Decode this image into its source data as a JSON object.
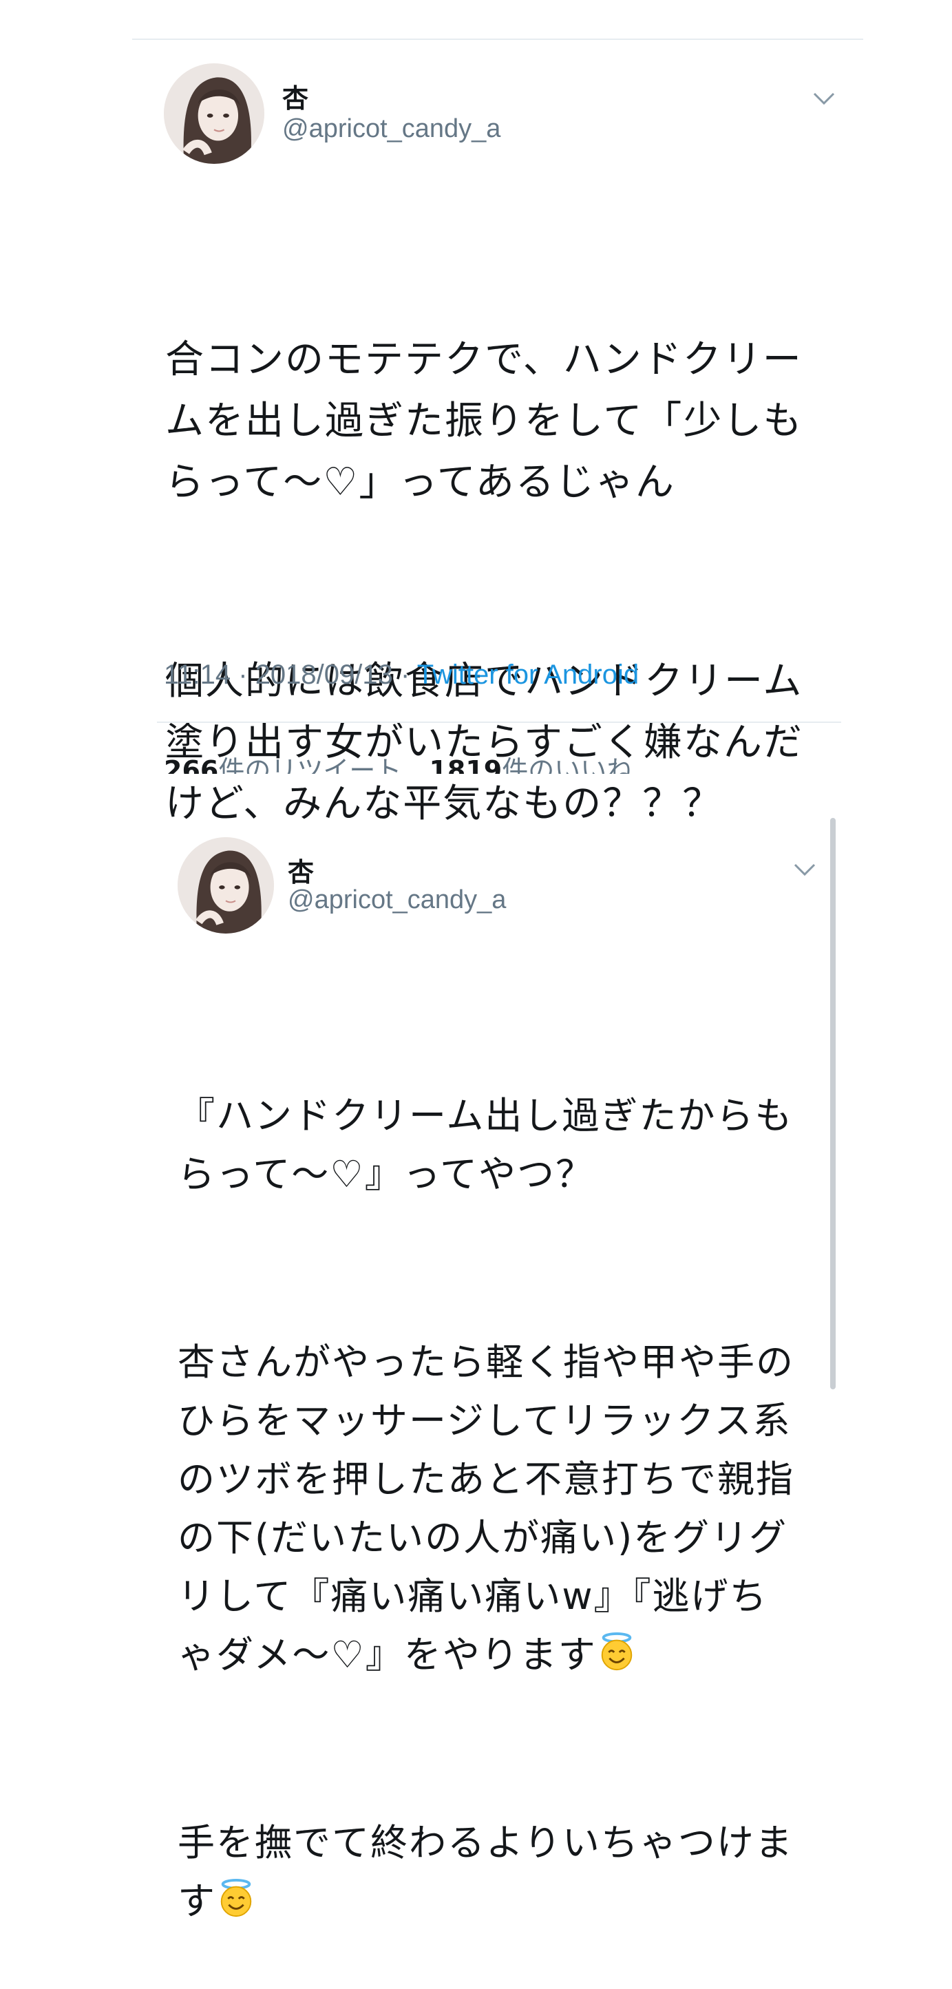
{
  "tweet": {
    "display_name": "杏",
    "handle": "@apricot_candy_a",
    "paragraphs": [
      "合コンのモテテクで、ハンドクリー\nムを出し過ぎた振りをして「少しも\nらって〜♡」ってあるじゃん",
      "個人的には飲食店でハンドクリーム\n塗り出す女がいたらすごく嫌なんだ\nけど、みんな平気なもの？？？"
    ],
    "time": "11:14",
    "date": "2018/09/13",
    "source": "Twitter for Android",
    "retweet_count": "266",
    "retweet_label": "件のリツイート",
    "like_count": "1819",
    "like_label": "件のいいね"
  },
  "reply": {
    "display_name": "杏",
    "handle": "@apricot_candy_a",
    "paragraph1": "『ハンドクリーム出し過ぎたからも\nらって〜♡』ってやつ？",
    "paragraph2": "杏さんがやったら軽く指や甲や手の\nひらをマッサージしてリラックス系\nのツボを押したあと不意打ちで親指\nの下(だいたいの人が痛い)をグリグ\nリして『痛い痛い痛いw』『逃げち\nゃダメ〜♡』をやります",
    "paragraph3": "手を撫でて終わるよりいちゃつけま\nす"
  },
  "icons": {
    "chevron": "chevron-down-icon",
    "emoji": "smiling-face-with-halo-emoji"
  },
  "colors": {
    "text": "#14171a",
    "secondary": "#657786",
    "link": "#1b95e0",
    "divider": "#e6ecf0"
  }
}
